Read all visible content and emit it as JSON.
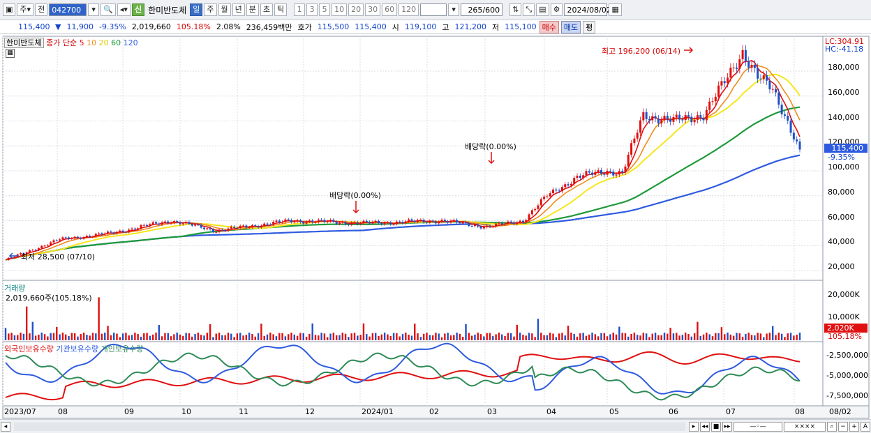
{
  "toolbar": {
    "period_label": "주",
    "prev_label": "전",
    "stock_code": "042700",
    "new_badge": "신",
    "stock_name": "한미반도체",
    "periods": [
      "일",
      "주",
      "월",
      "년",
      "분",
      "초",
      "틱"
    ],
    "active_period": "일",
    "intervals": [
      "1",
      "3",
      "5",
      "10",
      "20",
      "30",
      "60",
      "120"
    ],
    "count_value": "265",
    "count_max": "/600",
    "date_value": "2024/08/02"
  },
  "info": {
    "price": "115,400",
    "change": "11,900",
    "change_pct": "-9.35%",
    "volume": "2,019,660",
    "volume_ratio": "105.18%",
    "turnover": "2.08%",
    "amount": "236,459백만",
    "bid_label": "호가",
    "bid1": "115,500",
    "bid2": "115,400",
    "open_label": "시",
    "open": "119,100",
    "high_label": "고",
    "high": "121,200",
    "low_label": "저",
    "low": "115,100",
    "buy_label": "매수",
    "sell_label": "매도",
    "eval_label": "평"
  },
  "price_panel": {
    "stock_tag": "한미반도체",
    "ma_legend": "종가 단순",
    "ma_periods": [
      "5",
      "10",
      "20",
      "60",
      "120"
    ],
    "lc_label": "LC:304.91",
    "hc_label": "HC:-41.18",
    "y_ticks": [
      "180,000",
      "160,000",
      "140,000",
      "120,000",
      "100,000",
      "80,000",
      "60,000",
      "40,000",
      "20,000"
    ],
    "current_price_tag": "115,400",
    "current_pct_tag": "-9.35%",
    "annot_high": "최고 196,200 (06/14)",
    "annot_low": "최저 28,500 (07/10)",
    "annot_div1": "배당락(0.00%)",
    "annot_div2": "배당락(0.00%)"
  },
  "volume_panel": {
    "title": "거래량",
    "value": "2,019,660주(105.18%)",
    "y_ticks": [
      "20,000K",
      "10,000K"
    ],
    "current_tag": "2,020K",
    "current_pct": "105.18%"
  },
  "holding_panel": {
    "series": [
      "외국인보유수량",
      "기관보유수량",
      "개인보유수량"
    ],
    "y_ticks": [
      "-2,500,000",
      "-5,000,000",
      "-7,500,000"
    ]
  },
  "x_axis": {
    "labels": [
      "2023/07",
      "08",
      "09",
      "10",
      "11",
      "12",
      "2024/01",
      "02",
      "03",
      "04",
      "05",
      "06",
      "07",
      "08"
    ],
    "end_label": "08/02"
  },
  "colors": {
    "ma5": "#e01010",
    "ma10": "#f08c1e",
    "ma20": "#f5e61e",
    "ma60": "#1e9a3a",
    "ma120": "#2e5be0",
    "up": "#e01010",
    "down": "#1e50c8",
    "foreign": "#e01010",
    "institution": "#2e5be0",
    "individual": "#2e8b57"
  }
}
